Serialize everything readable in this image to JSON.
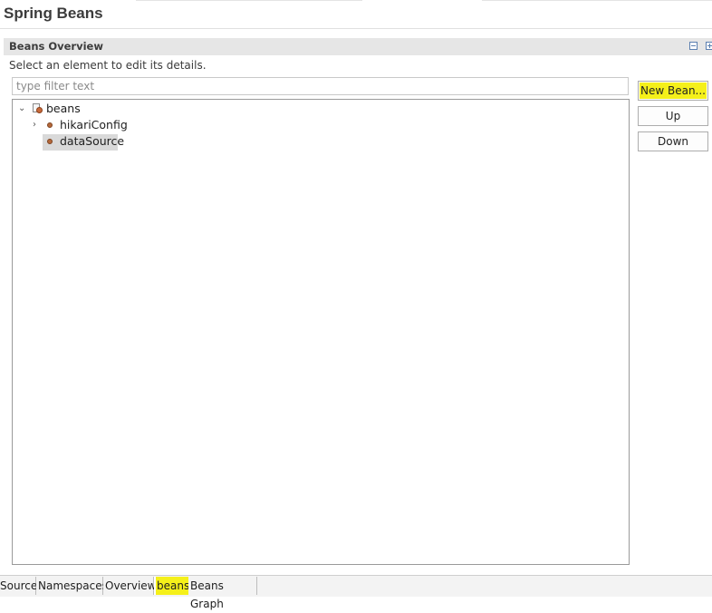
{
  "page": {
    "title": "Spring Beans"
  },
  "section": {
    "title": "Beans Overview",
    "description": "Select an element to edit its details.",
    "collapse_icon": "collapse-all-icon",
    "expand_icon": "expand-all-icon"
  },
  "filter": {
    "placeholder": "type filter text",
    "value": ""
  },
  "tree": {
    "root": {
      "label": "beans",
      "expanded": true,
      "icon": "beans-file-icon"
    },
    "children": [
      {
        "label": "hikariConfig",
        "expandable": true,
        "selected": false,
        "icon": "bean-icon"
      },
      {
        "label": "dataSource",
        "expandable": false,
        "selected": true,
        "icon": "bean-icon"
      }
    ]
  },
  "buttons": {
    "new_bean": "New Bean...",
    "up": "Up",
    "down": "Down"
  },
  "tabs": [
    {
      "label": "Source",
      "active": false
    },
    {
      "label": "Namespaces",
      "active": false
    },
    {
      "label": "Overview",
      "active": false
    },
    {
      "label": "beans",
      "active": true
    },
    {
      "label": "Beans Graph",
      "active": false
    }
  ],
  "colors": {
    "highlight": "#f5f01a",
    "bean": "#b5683a",
    "selection": "#d9d9d9"
  }
}
